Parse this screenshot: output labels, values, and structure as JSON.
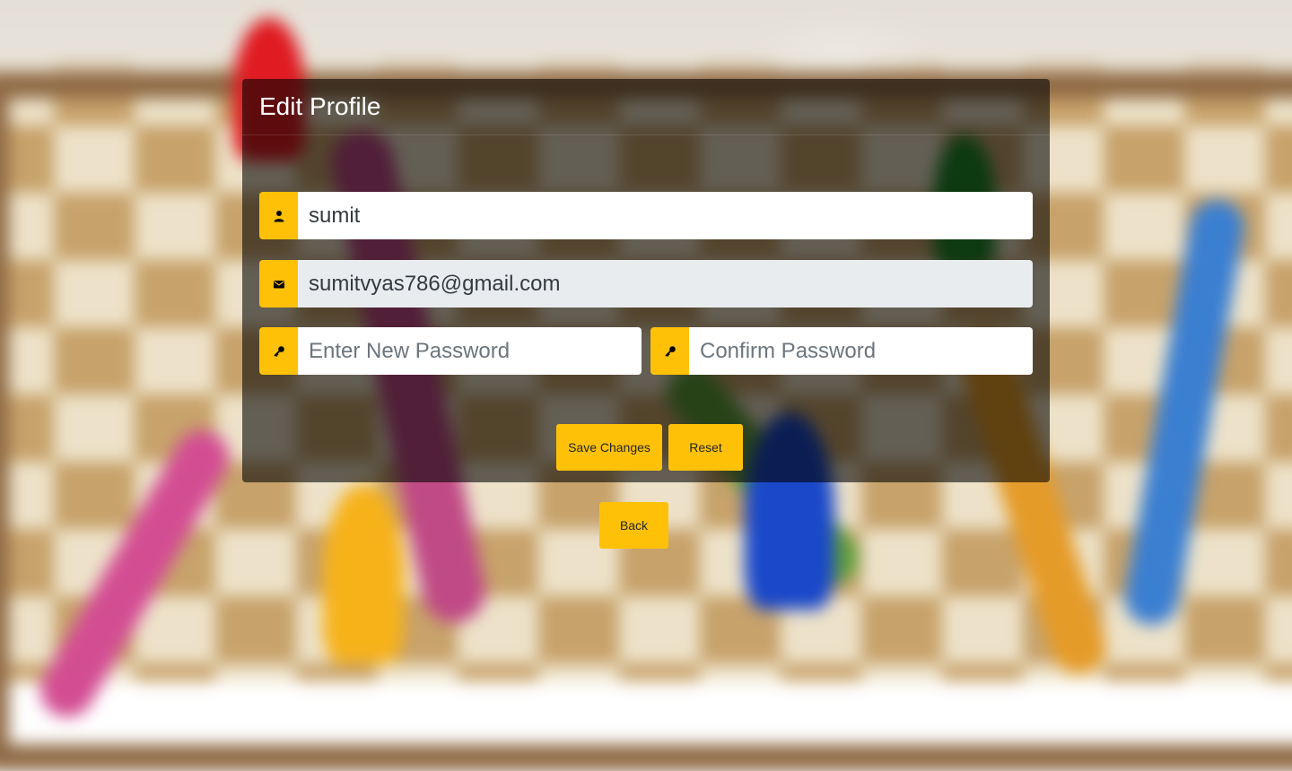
{
  "page": {
    "title": "Edit Profile"
  },
  "form": {
    "username": {
      "value": "sumit",
      "icon": "user-icon"
    },
    "email": {
      "value": "sumitvyas786@gmail.com",
      "icon": "envelope-icon"
    },
    "new_password": {
      "placeholder": "Enter New Password",
      "icon": "key-icon"
    },
    "confirm_password": {
      "placeholder": "Confirm Password",
      "icon": "key-icon"
    }
  },
  "buttons": {
    "save": "Save Changes",
    "reset": "Reset",
    "back": "Back"
  },
  "colors": {
    "accent": "#ffc107",
    "panel_overlay": "rgba(0,0,0,0.58)"
  }
}
